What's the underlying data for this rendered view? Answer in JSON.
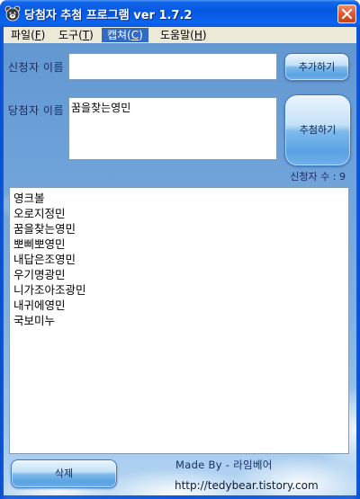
{
  "window": {
    "title": "당첨자 추첨 프로그램 ver 1.7.2",
    "icon": "bear-icon",
    "close_icon": "close-icon"
  },
  "menu": [
    {
      "pre": "파일(",
      "key": "F",
      "post": ")",
      "highlighted": false
    },
    {
      "pre": "도구(",
      "key": "T",
      "post": ")",
      "highlighted": false
    },
    {
      "pre": "캡쳐(",
      "key": "C",
      "post": ")",
      "highlighted": true
    },
    {
      "pre": "도움말(",
      "key": "H",
      "post": ")",
      "highlighted": false
    }
  ],
  "form": {
    "applicant_label": "신청자 이름",
    "applicant_input": {
      "value": ""
    },
    "add_button": "추가하기",
    "winner_label": "당첨자 이름",
    "winner_value": "꿈을찾는영민",
    "draw_button": "추첨하기",
    "count_label": "신청자 수 :",
    "count": "9"
  },
  "list": {
    "items": [
      "영크볼",
      "오로지정민",
      "꿈을찾는영민",
      "뽀삐뽀영민",
      "내답은조영민",
      "우기명광민",
      "니가조아조광민",
      "내귀에영민",
      "국보미누"
    ]
  },
  "footer": {
    "delete_button": "삭제",
    "credit": "Made By - 라임베어",
    "url": "http://tedybear.tistory.com"
  },
  "colors": {
    "title_bar": "#0a5fe4",
    "menu_bar": "#ece9d8",
    "menu_highlight": "#316ac5",
    "sky": "#76a8dd",
    "label_text": "#1b2d63",
    "close_button": "#d9522c"
  }
}
